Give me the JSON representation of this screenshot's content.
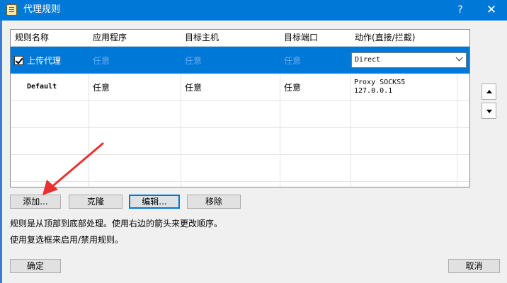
{
  "window": {
    "title": "代理规则",
    "help_label": "?",
    "close_label": "✕",
    "icon": "proxy-rules-window-icon"
  },
  "table": {
    "columns": [
      "规则名称",
      "应用程序",
      "目标主机",
      "目标端口",
      "动作(直接/拦截)"
    ],
    "rows": [
      {
        "checked": true,
        "name": "上传代理",
        "application": "任意",
        "target_host": "任意",
        "target_port": "任意",
        "action": "Direct",
        "selected": true
      },
      {
        "checked": null,
        "name": "Default",
        "application": "任意",
        "target_host": "任意",
        "target_port": "任意",
        "action_line1": "Proxy SOCKS5",
        "action_line2": "127.0.0.1",
        "selected": false
      }
    ]
  },
  "side_buttons": {
    "up_icon": "triangle-up-icon",
    "down_icon": "triangle-down-icon"
  },
  "buttons": {
    "add": "添加...",
    "clone": "克隆",
    "edit": "编辑...",
    "remove": "移除",
    "ok": "确定",
    "cancel": "取消"
  },
  "info": {
    "line1": "规则是从顶部到底部处理。使用右边的箭头来更改顺序。",
    "line2": "使用复选框来启用/禁用规则。"
  },
  "colors": {
    "titlebar": "#0078d7",
    "selection": "#0078d7",
    "annotation_arrow": "#e8312f"
  }
}
